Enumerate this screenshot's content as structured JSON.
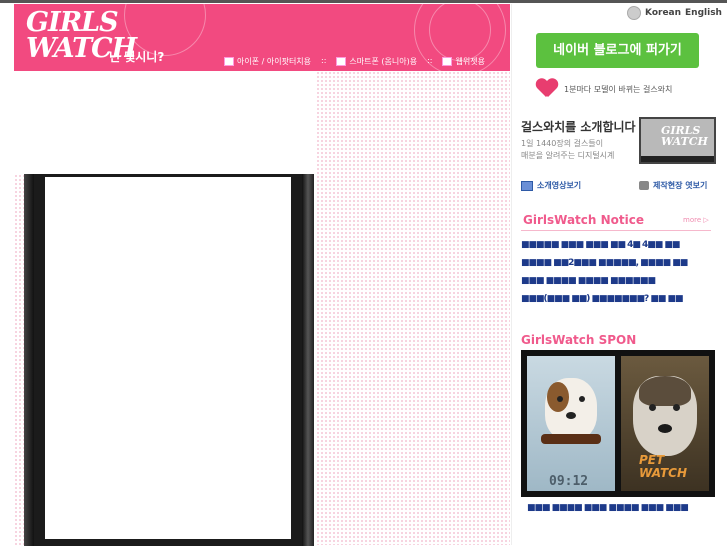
{
  "header": {
    "logo_line1": "GIRLS",
    "logo_line2": "WATCH",
    "tagline": "넌 몇시니?",
    "nav": [
      {
        "label": "아이폰 / 아이팟터치용"
      },
      {
        "label": "스마트폰 (옴니아)용"
      },
      {
        "label": "웹위젯용"
      }
    ],
    "nav_separator": "::"
  },
  "language": {
    "korean": "Korean",
    "english": "English"
  },
  "naver_button": "네이버 블로그에 퍼가기",
  "promo_text": "1분마다 모델이 바뀌는 걸스와치",
  "intro": {
    "title": "걸스와치를 소개합니다",
    "desc_line1": "1일 1440장의 걸스들이",
    "desc_line2": "매분을 알려주는 디지털시계",
    "mini_logo1": "GIRLS",
    "mini_logo2": "WATCH"
  },
  "links": {
    "video": "소개영상보기",
    "making": "제작현장 엿보기"
  },
  "notice": {
    "title": "GirlsWatch  Notice",
    "more": "more ▷",
    "items": [
      "■■■■■ ■■■ ■■■ ■■ 4■ 4■■ ■■",
      "■■■■ ■■2■■■ ■■■■■, ■■■■ ■■",
      "■■■ ■■■■ ■■■■ ■■■■■■",
      "■■■(■■■ ■■) ■■■■■■■? ■■ ■■"
    ]
  },
  "spon": {
    "title": "GirlsWatch  SPON",
    "time": "09:12",
    "pet_line1": "PET",
    "pet_line2": "WATCH",
    "caption": "■■■ ■■■■ ■■■ ■■■■ ■■■ ■■■"
  }
}
